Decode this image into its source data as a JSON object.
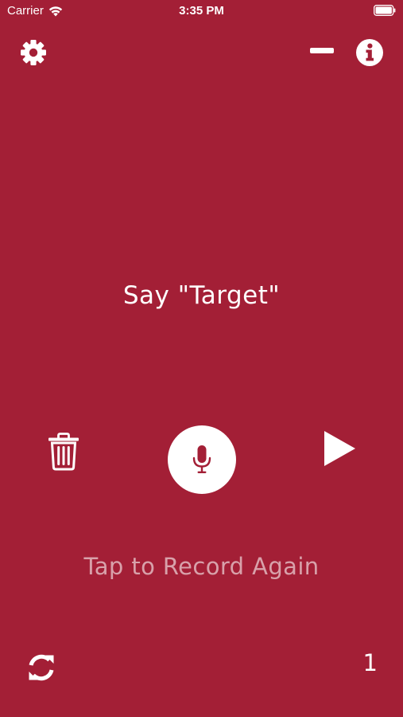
{
  "status_bar": {
    "carrier": "Carrier",
    "time": "3:35 PM"
  },
  "toolbar": {
    "settings_icon": "gear-icon",
    "minimize_icon": "minus-icon",
    "info_icon": "info-circle-icon"
  },
  "main": {
    "prompt": "Say \"Target\"",
    "hint": "Tap to Record Again",
    "counter": "1"
  },
  "controls": {
    "delete_icon": "trash-icon",
    "record_icon": "microphone-icon",
    "play_icon": "play-icon",
    "refresh_icon": "refresh-icon"
  },
  "colors": {
    "background": "#a31f36",
    "foreground": "#ffffff",
    "hint_text": "rgba(255,255,255,0.58)"
  }
}
